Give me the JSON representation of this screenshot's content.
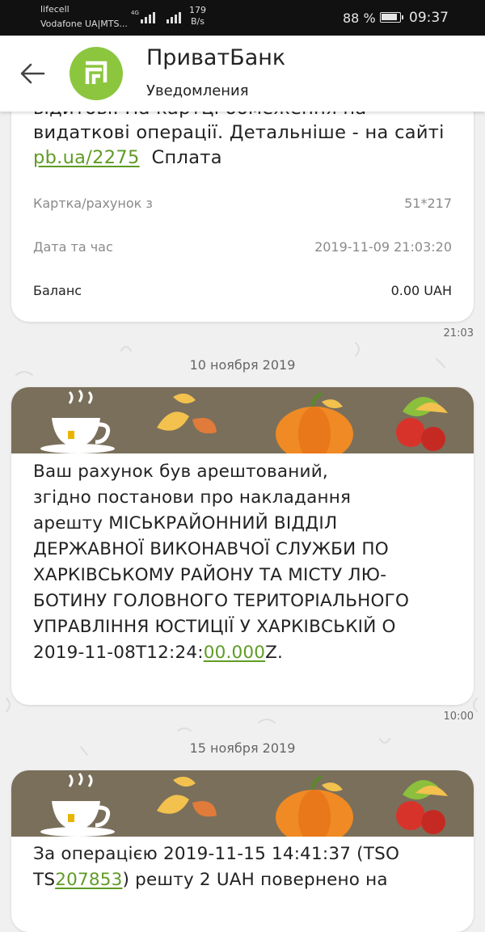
{
  "status_bar": {
    "operator_1": "lifecell",
    "operator_2": "Vodafone UA|MTS...",
    "network": "4G",
    "speed_value": "179",
    "speed_unit": "B/s",
    "battery_percent": "88 %",
    "time": "09:37"
  },
  "header": {
    "back_icon": "arrow-left-icon",
    "app_name": "ПриватБанк",
    "subtitle": "Уведомления",
    "logo_icon": "privatbank-logo"
  },
  "messages": [
    {
      "text_cut": "відитові. На картці обмеження на",
      "text_line2": "видаткові операції. Детальніше - на сайті",
      "link": "pb.ua/2275",
      "text_after_link": "Сплата",
      "rows": [
        {
          "label": "Картка/рахунок з",
          "value": "51*217"
        },
        {
          "label": "Дата та час",
          "value": "2019-11-09 21:03:20"
        },
        {
          "label": "Баланс",
          "value": "0.00 UAH"
        }
      ],
      "time": "21:03"
    },
    {
      "date": "10 ноября 2019",
      "lines": [
        "Ваш рахунок був арештований,",
        "згідно постанови про накладання",
        "арешту МІСЬКРАЙОННИЙ ВІДДІЛ",
        "ДЕРЖАВНОЇ ВИКОНАВЧОЇ СЛУЖБИ ПО",
        "ХАРКІВСЬКОМУ РАЙОНУ ТА МІСТУ ЛЮ-",
        "БОТИНУ ГОЛОВНОГО ТЕРИТОРІАЛЬНОГО",
        "УПРАВЛІННЯ ЮСТИЦІЇ У ХАРКІВСЬКІЙ О"
      ],
      "last_prefix": "2019-11-08T12:24:",
      "last_link": "00.000",
      "last_suffix": "Z.",
      "time": "10:00"
    },
    {
      "date": "15 ноября 2019",
      "line1": "За операцією 2019-11-15 14:41:37 (TSO",
      "line2_prefix": "TS",
      "line2_link": "207853",
      "line2_suffix": ") решту 2 UAH повернено на"
    }
  ]
}
